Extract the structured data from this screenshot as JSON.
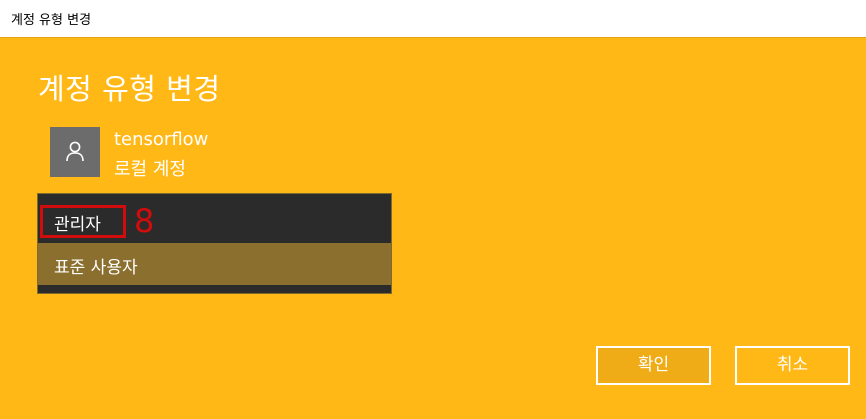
{
  "window": {
    "title": "계정 유형 변경"
  },
  "dialog": {
    "heading": "계정 유형 변경",
    "account": {
      "avatar_icon": "user-icon",
      "name": "tensorflow",
      "kind": "로컬 계정"
    },
    "account_type_options": [
      {
        "label": "관리자"
      },
      {
        "label": "표준 사용자"
      }
    ],
    "annotation_number": "8",
    "buttons": {
      "ok_label": "확인",
      "cancel_label": "취소"
    }
  },
  "colors": {
    "background": "#ffb816",
    "list_background": "#2b2b2b",
    "selected_option": "#8b6f2e",
    "annotation_red": "#d10c0c"
  }
}
